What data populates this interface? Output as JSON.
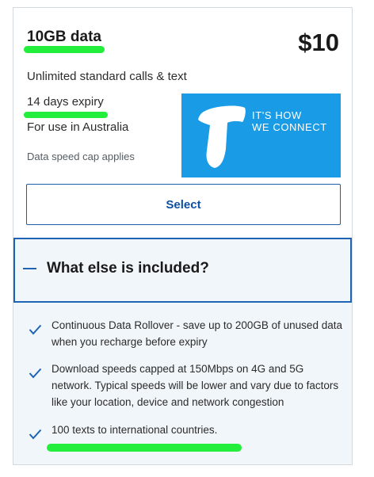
{
  "plan": {
    "title": "10GB data",
    "price": "$10",
    "calls": "Unlimited standard calls & text",
    "expiry": "14 days expiry",
    "region": "For use in Australia",
    "speed_note": "Data speed cap applies"
  },
  "banner": {
    "brand_icon": "telstra-t-logo",
    "tagline": "IT'S HOW\nWE CONNECT",
    "color": "#1a9be6"
  },
  "actions": {
    "select_label": "Select"
  },
  "accordion": {
    "title": "What else is included?",
    "expanded": true,
    "icon": "minus-icon"
  },
  "included_items": [
    {
      "icon": "check-icon",
      "text": "Continuous Data Rollover - save up to 200GB of unused data when you recharge before expiry"
    },
    {
      "icon": "check-icon",
      "text": "Download speeds capped at 150Mbps on 4G and 5G network. Typical speeds will be lower and vary due to factors like your location, device and network congestion"
    },
    {
      "icon": "check-icon",
      "text": "100 texts to international countries."
    }
  ],
  "colors": {
    "accent": "#1d64b5",
    "highlight": "#23ee3b",
    "panel": "#f1f6fa"
  }
}
